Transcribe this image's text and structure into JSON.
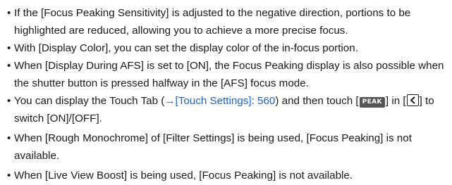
{
  "items": [
    {
      "bullet": "•",
      "text": "If the [Focus Peaking Sensitivity] is adjusted to the negative direction, portions to be highlighted are reduced, allowing you to achieve a more precise focus."
    },
    {
      "bullet": "•",
      "text": "With [Display Color], you can set the display color of the in-focus portion."
    },
    {
      "bullet": "•",
      "text": "When [Display During AFS] is set to [ON], the Focus Peaking display is also possible when the shutter button is pressed halfway in the [AFS] focus mode."
    },
    {
      "bullet": "•",
      "text_before": "You can display the Touch Tab (",
      "arrow": "→",
      "link": "[Touch Settings]: 560",
      "text_mid": ") and then touch [",
      "badge": "PEAK",
      "text_mid2": "] in [",
      "icon_name": "chevron-left-icon",
      "text_after": "] to switch [ON]/[OFF]."
    },
    {
      "bullet": "•",
      "text": "When [Rough Monochrome] of [Filter Settings] is being used, [Focus Peaking] is not available."
    },
    {
      "bullet": "•",
      "text": "When [Live View Boost] is being used, [Focus Peaking] is not available."
    }
  ],
  "colors": {
    "text": "#1a1a1a",
    "link": "#1f63c6",
    "badge_bg": "#555555"
  }
}
